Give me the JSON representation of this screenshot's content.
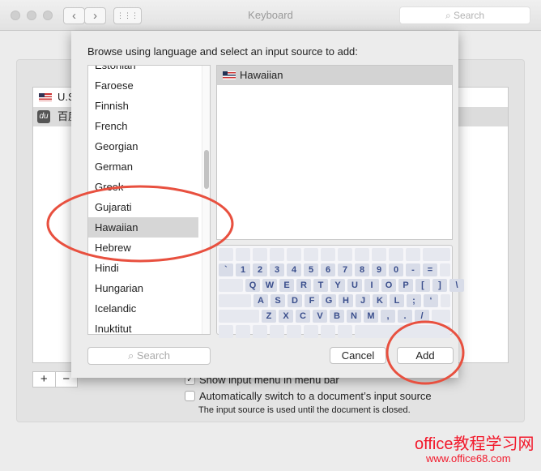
{
  "window": {
    "title": "Keyboard",
    "search_placeholder": "Search",
    "back": "‹",
    "forward": "›",
    "grid": "⋮⋮⋮"
  },
  "sources": [
    {
      "label": "U.S.",
      "icon": "us-flag-icon"
    },
    {
      "label": "百度",
      "icon": "baidu-icon"
    }
  ],
  "plus": "+",
  "minus": "−",
  "options": {
    "show_menu": "Show input menu in menu bar",
    "show_menu_checked": true,
    "auto_switch": "Automatically switch to a document’s input source",
    "auto_switch_checked": false,
    "note": "The input source is used until the document is closed."
  },
  "sheet": {
    "prompt": "Browse using language and select an input source to add:",
    "languages": [
      "Estonian",
      "Faroese",
      "Finnish",
      "French",
      "Georgian",
      "German",
      "Greek",
      "Gujarati",
      "Hawaiian",
      "Hebrew",
      "Hindi",
      "Hungarian",
      "Icelandic",
      "Inuktitut"
    ],
    "selected_language": "Hawaiian",
    "input_source": "Hawaiian",
    "keyboard_rows": [
      [
        "`",
        "1",
        "2",
        "3",
        "4",
        "5",
        "6",
        "7",
        "8",
        "9",
        "0",
        "-",
        "="
      ],
      [
        "Q",
        "W",
        "E",
        "R",
        "T",
        "Y",
        "U",
        "I",
        "O",
        "P",
        "[",
        "]",
        "\\"
      ],
      [
        "A",
        "S",
        "D",
        "F",
        "G",
        "H",
        "J",
        "K",
        "L",
        ";",
        "‘"
      ],
      [
        "Z",
        "X",
        "C",
        "V",
        "B",
        "N",
        "M",
        ",",
        ".",
        "/"
      ]
    ],
    "search_placeholder": "Search",
    "cancel": "Cancel",
    "add": "Add"
  },
  "annotation_color": "#e8503f",
  "watermark": {
    "line1": "office教程学习网",
    "line2": "www.office68.com"
  }
}
